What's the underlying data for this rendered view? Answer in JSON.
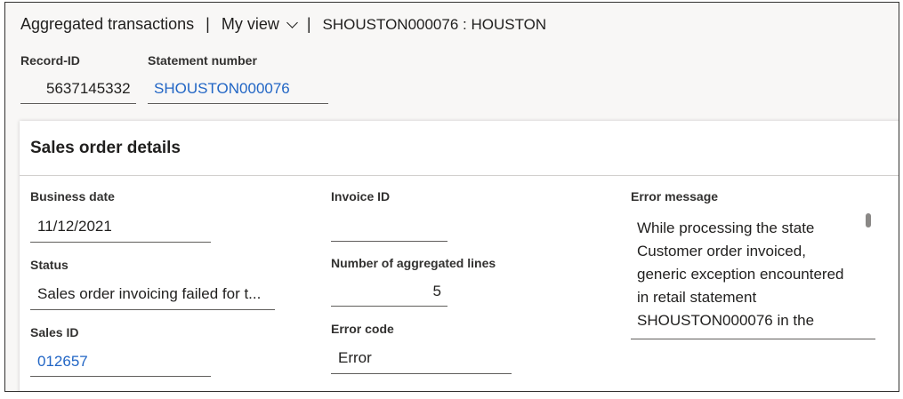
{
  "header": {
    "title": "Aggregated transactions",
    "separator": "|",
    "view_label": "My view",
    "record_title": "SHOUSTON000076 : HOUSTON",
    "icons": {
      "view_dropdown": "chevron-down-icon"
    }
  },
  "record": {
    "record_id_label": "Record-ID",
    "record_id_value": "5637145332",
    "statement_label": "Statement number",
    "statement_value": "SHOUSTON000076"
  },
  "card": {
    "title": "Sales order details",
    "business_date_label": "Business date",
    "business_date_value": "11/12/2021",
    "status_label": "Status",
    "status_value": "Sales order invoicing failed for t...",
    "sales_id_label": "Sales ID",
    "sales_id_value": "012657",
    "invoice_id_label": "Invoice ID",
    "invoice_id_value": "",
    "agg_lines_label": "Number of aggregated lines",
    "agg_lines_value": "5",
    "error_code_label": "Error code",
    "error_code_value": "Error",
    "error_message_label": "Error message",
    "error_message_value": "While processing the state Customer order invoiced, generic exception encountered in retail statement SHOUSTON000076 in the"
  },
  "colors": {
    "link": "#2266c5",
    "text": "#201f1e"
  }
}
